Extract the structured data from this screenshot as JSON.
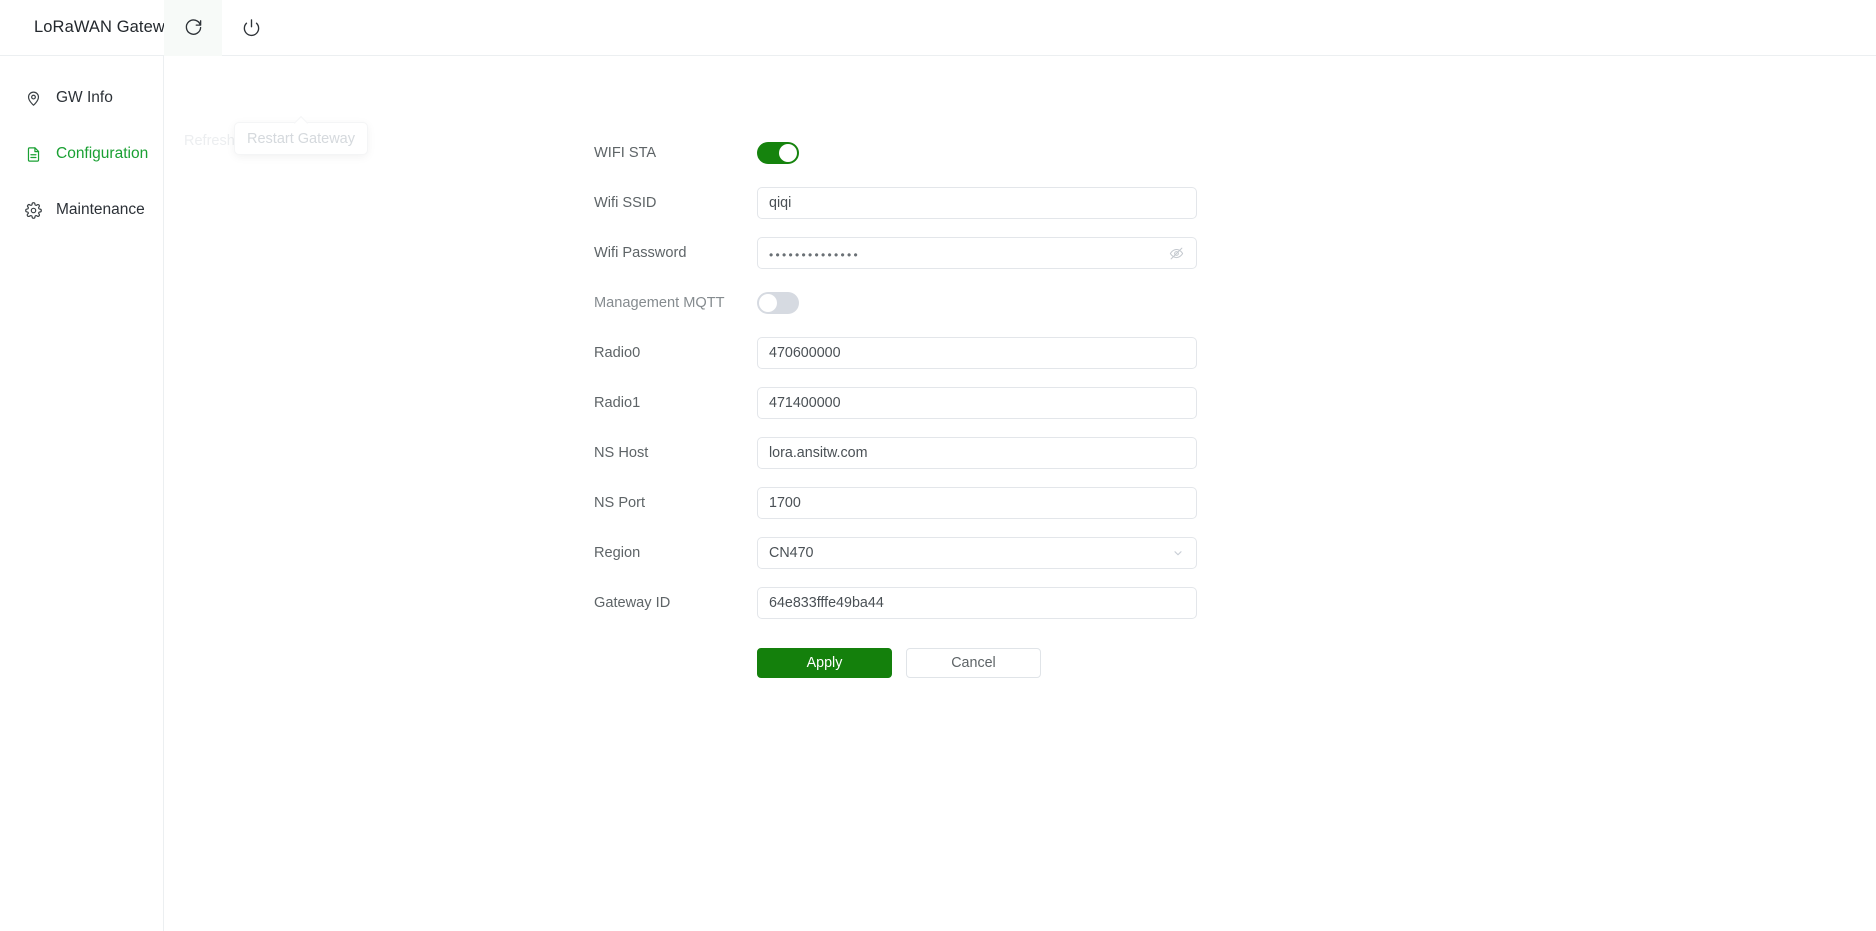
{
  "header": {
    "brand": "LoRaWAN Gateway",
    "refresh_icon": "refresh-icon",
    "power_icon": "power-icon"
  },
  "tooltips": {
    "refresh": "Refresh Page",
    "restart": "Restart Gateway"
  },
  "sidebar": {
    "items": [
      {
        "label": "GW Info",
        "icon": "location-pin-icon",
        "active": false
      },
      {
        "label": "Configuration",
        "icon": "document-icon",
        "active": true
      },
      {
        "label": "Maintenance",
        "icon": "gear-icon",
        "active": false
      }
    ]
  },
  "form": {
    "wifi_sta": {
      "label": "WIFI STA",
      "state": "on"
    },
    "wifi_ssid": {
      "label": "Wifi SSID",
      "value": "qiqi"
    },
    "wifi_password": {
      "label": "Wifi Password",
      "value": "••••••••••••••",
      "reveal_icon": "eye-off-icon"
    },
    "management_mqtt": {
      "label": "Management MQTT",
      "state": "off"
    },
    "radio0": {
      "label": "Radio0",
      "value": "470600000"
    },
    "radio1": {
      "label": "Radio1",
      "value": "471400000"
    },
    "ns_host": {
      "label": "NS Host",
      "value": "lora.ansitw.com"
    },
    "ns_port": {
      "label": "NS Port",
      "value": "1700"
    },
    "region": {
      "label": "Region",
      "value": "CN470",
      "chevron_icon": "chevron-down-icon"
    },
    "gateway_id": {
      "label": "Gateway ID",
      "value": "64e833fffe49ba44"
    },
    "apply_label": "Apply",
    "cancel_label": "Cancel"
  },
  "colors": {
    "accent_green": "#14800c",
    "active_nav": "#1aa033",
    "toggle_off": "#d6dae1"
  }
}
